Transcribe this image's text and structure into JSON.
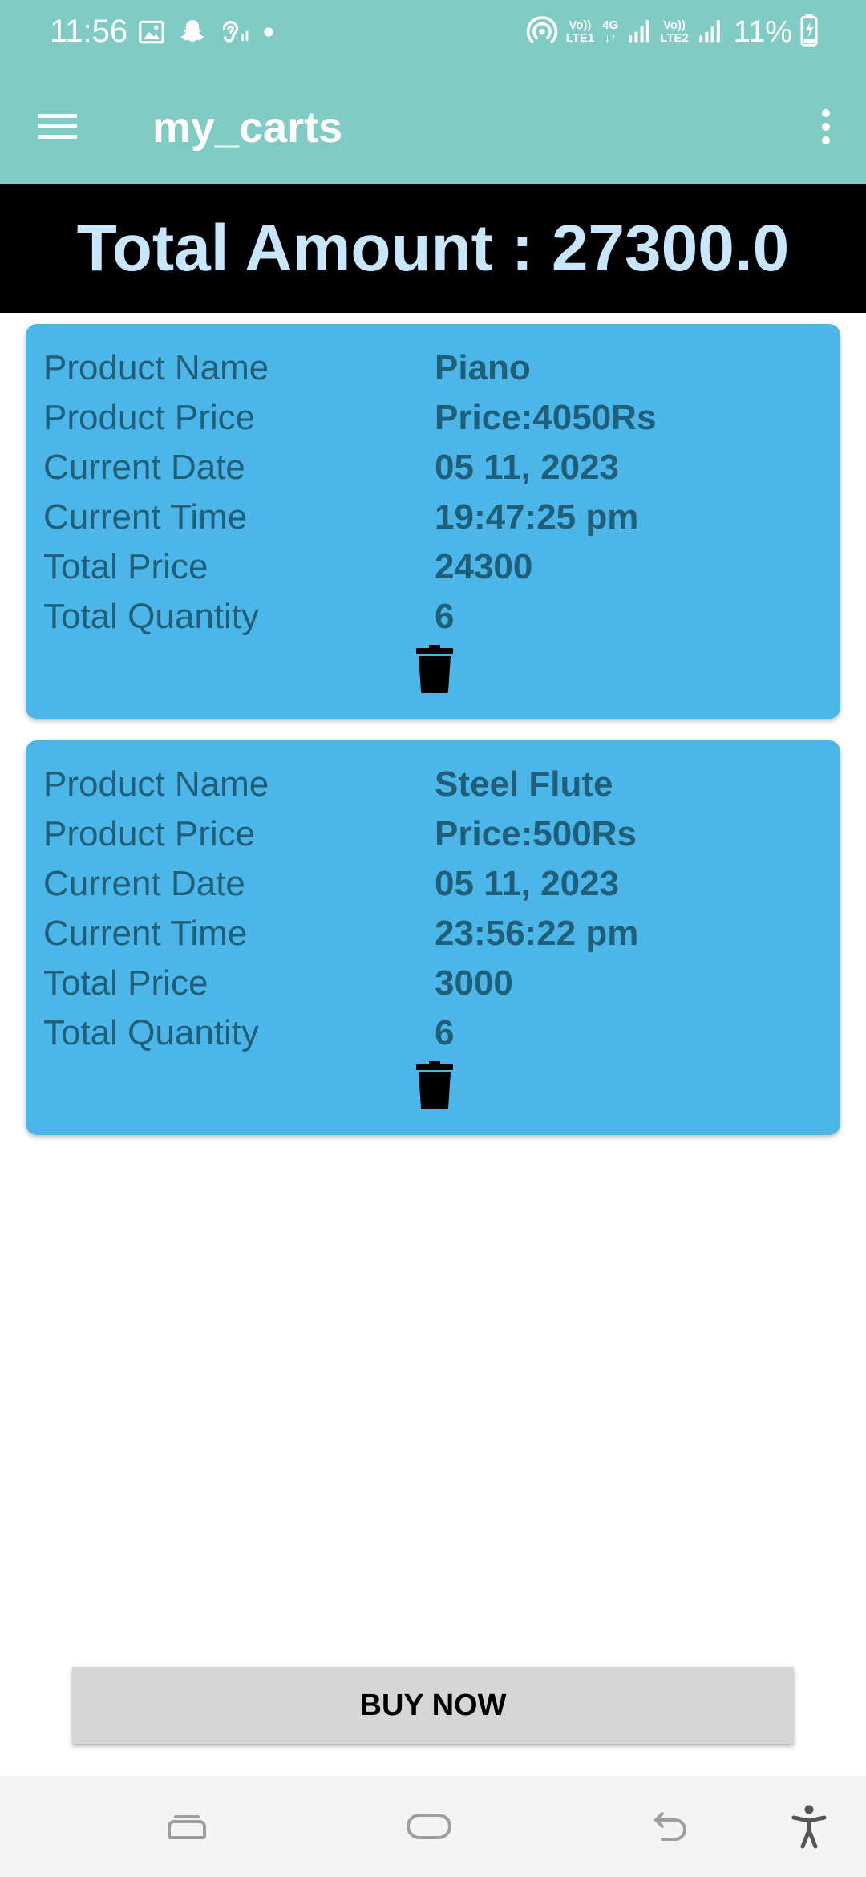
{
  "status_bar": {
    "time": "11:56",
    "net1_top": "Vo))",
    "net1_bottom": "LTE1",
    "net_4g_top": "4G",
    "net_4g_bottom": "↓↑",
    "net2_top": "Vo))",
    "net2_bottom": "LTE2",
    "battery": "11%",
    "icons": [
      "image-icon",
      "snapchat-icon",
      "hearing-icon",
      "dot-icon",
      "hotspot-icon",
      "signal-icon",
      "signal-icon",
      "battery-charging-icon"
    ]
  },
  "app_bar": {
    "title": "my_carts",
    "icons": [
      "menu-icon",
      "more-vert-icon"
    ]
  },
  "total": {
    "text": "Total Amount : 27300.0"
  },
  "cart": {
    "labels": {
      "name": "Product Name",
      "price": "Product Price",
      "date": "Current Date",
      "time": "Current Time",
      "total_price": "Total Price",
      "quantity": "Total Quantity"
    },
    "items": [
      {
        "name": "Piano",
        "price": "Price:4050Rs",
        "date": "05 11, 2023",
        "time": "19:47:25 pm",
        "total_price": "24300",
        "quantity": "6"
      },
      {
        "name": "Steel Flute",
        "price": "Price:500Rs",
        "date": "05 11, 2023",
        "time": "23:56:22 pm",
        "total_price": "3000",
        "quantity": "6"
      }
    ]
  },
  "buy_button": {
    "label": "BUY NOW"
  },
  "nav_bar": {
    "icons": [
      "recents-icon",
      "home-icon",
      "back-icon",
      "accessibility-icon"
    ]
  },
  "colors": {
    "app_bar": "#80cbc4",
    "banner": "#000000",
    "banner_text": "#c9e6ff",
    "card": "#4db6e9",
    "card_text": "#1f5f79",
    "button": "#d6d6d6",
    "nav_bar": "#f4f4f4"
  }
}
